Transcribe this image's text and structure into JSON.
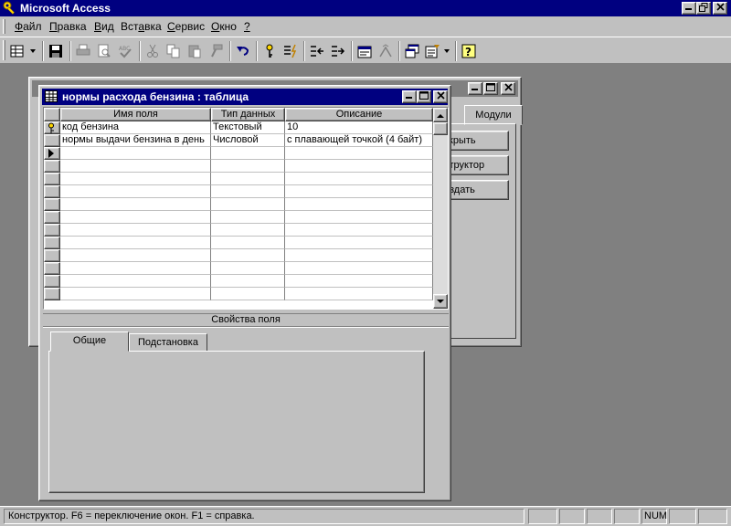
{
  "app": {
    "title": "Microsoft Access"
  },
  "menu": {
    "items": [
      {
        "u": "Ф",
        "rest": "айл"
      },
      {
        "u": "П",
        "rest": "равка"
      },
      {
        "u": "В",
        "rest": "ид"
      },
      {
        "u": "",
        "pre": "Вст",
        "mid": "а",
        "rest": "вка"
      },
      {
        "u": "С",
        "rest": "ервис"
      },
      {
        "u": "О",
        "rest": "кно"
      },
      {
        "u": "?",
        "rest": ""
      }
    ]
  },
  "db_window": {
    "tab_modules": "Модули",
    "buttons": [
      "ткрыть",
      "структор",
      "оздать"
    ]
  },
  "design_window": {
    "title": "нормы расхода бензина : таблица",
    "columns": [
      "Имя поля",
      "Тип данных",
      "Описание"
    ],
    "rows": [
      {
        "name": "код бензина",
        "type": "Текстовый",
        "desc": "10",
        "key": true
      },
      {
        "name": "нормы выдачи бензина в день",
        "type": "Числовой",
        "desc": "с плавающей точкой (4 байт)",
        "key": false
      }
    ],
    "props_label": "Свойства поля",
    "tabs": [
      "Общие",
      "Подстановка"
    ]
  },
  "status": {
    "text": "Конструктор.  F6 = переключение окон.  F1 = справка.",
    "num": "NUM"
  }
}
